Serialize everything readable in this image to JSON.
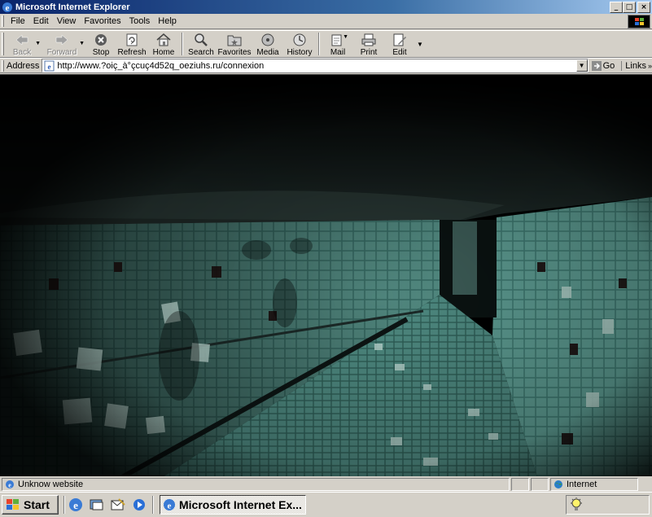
{
  "window": {
    "title": "Microsoft Internet Explorer",
    "min": "_",
    "max": "□",
    "close": "×"
  },
  "menu": [
    "File",
    "Edit",
    "View",
    "Favorites",
    "Tools",
    "Help"
  ],
  "toolbar": {
    "back": "Back",
    "forward": "Forward",
    "stop": "Stop",
    "refresh": "Refresh",
    "home": "Home",
    "search": "Search",
    "favorites": "Favorites",
    "media": "Media",
    "history": "History",
    "mail": "Mail",
    "print": "Print",
    "edit": "Edit"
  },
  "address": {
    "label": "Address",
    "url": "http://www.?oiç_à°çcuç4d52q_oeziuhs.ru/connexion",
    "go": "Go",
    "links": "Links"
  },
  "status": {
    "text": "Unknow website",
    "zone": "Internet"
  },
  "taskbar": {
    "start": "Start",
    "task": "Microsoft Internet Ex..."
  },
  "colors": {
    "titlebar": "#0a246a",
    "chrome": "#d4d0c8",
    "tile": "#3f7a72"
  }
}
